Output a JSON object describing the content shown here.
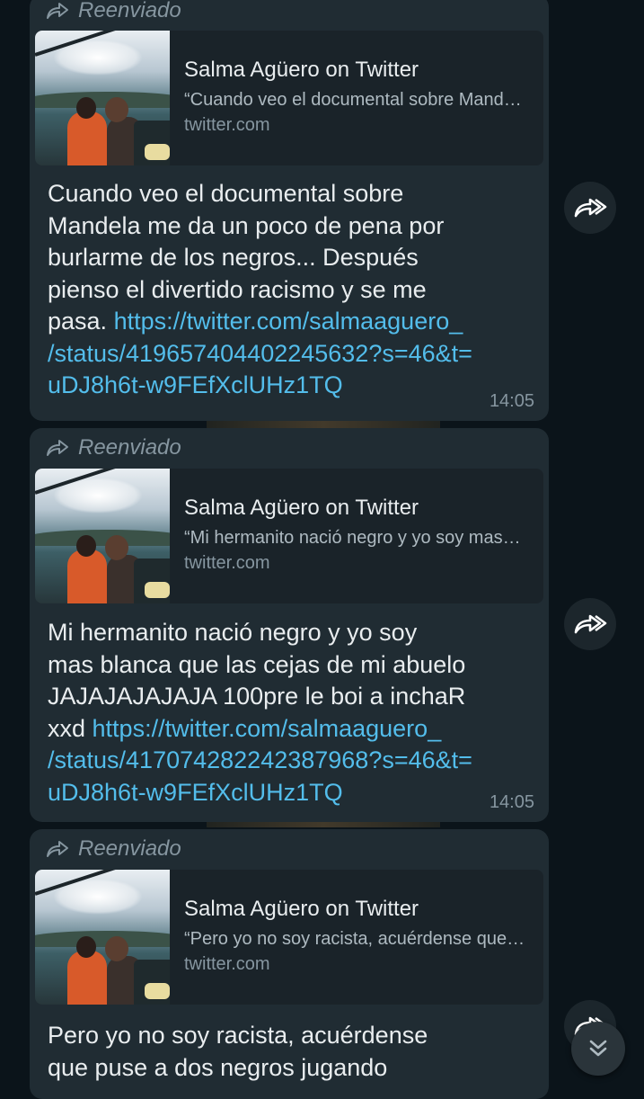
{
  "messages": [
    {
      "forwarded_label": "Reenviado",
      "preview": {
        "title": "Salma Agüero on Twitter",
        "description": "“Cuando veo el documental sobre Mandela me da un poco de pena por burlarme de los negros...",
        "domain": "twitter.com"
      },
      "text": "Cuando veo el documental sobre\nMandela me da un poco de pena por\nburlarme de los negros... Después\npienso el divertido racismo y se me\npasa. ",
      "link": "https://twitter.com/salmaaguero_\n/status/419657404402245632?s=46&t=\nuDJ8h6t-w9FEfXclUHz1TQ",
      "time": "14:05"
    },
    {
      "forwarded_label": "Reenviado",
      "preview": {
        "title": "Salma Agüero on Twitter",
        "description": "“Mi hermanito nació negro y yo soy mas blanca que las cejas de mi abuelo",
        "domain": "twitter.com"
      },
      "text": "Mi hermanito nació negro y yo soy\nmas blanca que las cejas de mi abuelo\nJAJAJAJAJAJA 100pre le boi a inchaR\nxxd ",
      "link": "https://twitter.com/salmaaguero_\n/status/417074282242387968?s=46&t=\nuDJ8h6t-w9FEfXclUHz1TQ",
      "time": "14:05"
    },
    {
      "forwarded_label": "Reenviado",
      "preview": {
        "title": "Salma Agüero on Twitter",
        "description": "“Pero yo no soy racista, acuérdense que puse a dos negros jugando",
        "domain": "twitter.com"
      },
      "text": "Pero yo no soy racista, acuérdense\nque puse a dos negros jugando",
      "link": "",
      "time": ""
    }
  ],
  "icons": {
    "forwarded": "forwarded-arrow-icon",
    "forward_button": "forward-arrow-icon",
    "scroll_down": "double-chevron-down-icon"
  },
  "colors": {
    "background": "#0b141a",
    "bubble": "#202c33",
    "link": "#53bdeb",
    "meta": "#8696a0"
  }
}
